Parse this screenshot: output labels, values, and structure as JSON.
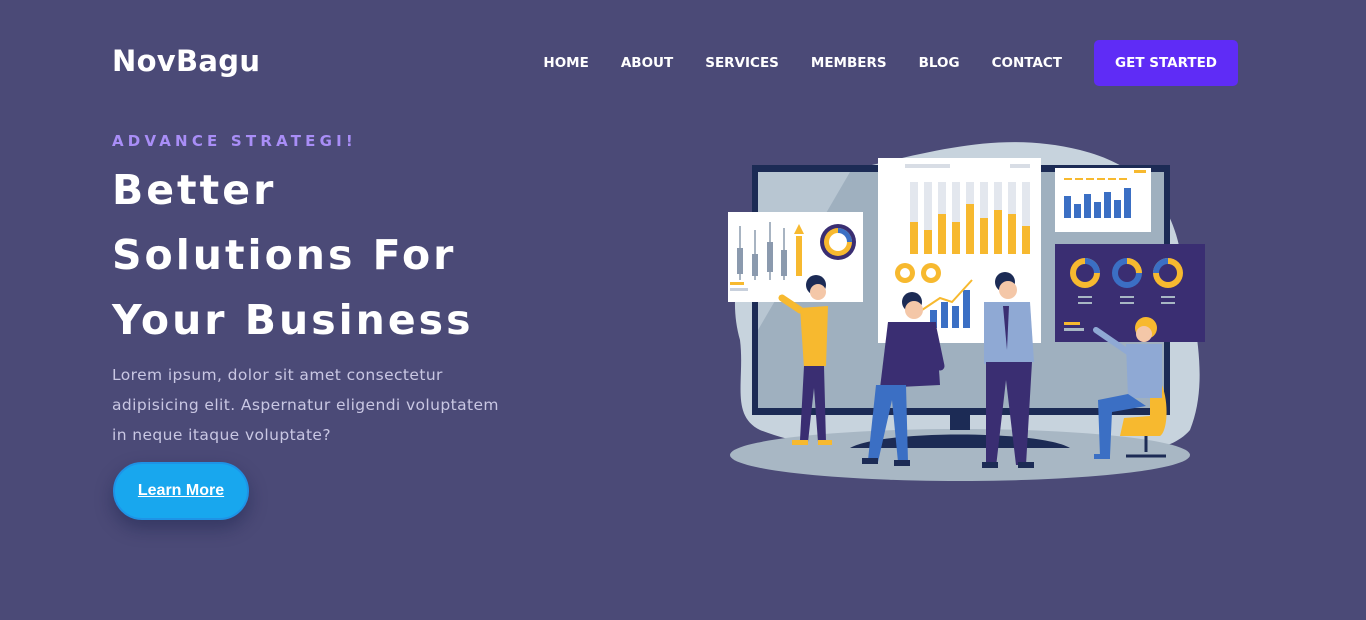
{
  "brand": {
    "name": "NovBagu"
  },
  "nav": {
    "items": [
      "HOME",
      "ABOUT",
      "SERVICES",
      "MEMBERS",
      "BLOG",
      "CONTACT"
    ],
    "cta": "GET STARTED"
  },
  "hero": {
    "eyebrow": "ADVANCE STRATEGI!",
    "title_lines": [
      "Better",
      "Solutions For",
      "Your Business"
    ],
    "lede": "Lorem ipsum, dolor sit amet consectetur adipisicing elit. Aspernatur eligendi voluptatem in neque itaque voluptate?",
    "button": "Learn More"
  },
  "colors": {
    "background": "#4b4a77",
    "accent": "#5f2cf6",
    "eyebrow": "#a98ef7",
    "button": "#18a7ee",
    "chart_yellow": "#f7b92f",
    "chart_blue": "#3b6fc4",
    "panel_navy": "#3a2e72"
  },
  "illustration": {
    "name": "business-analytics-illustration"
  }
}
